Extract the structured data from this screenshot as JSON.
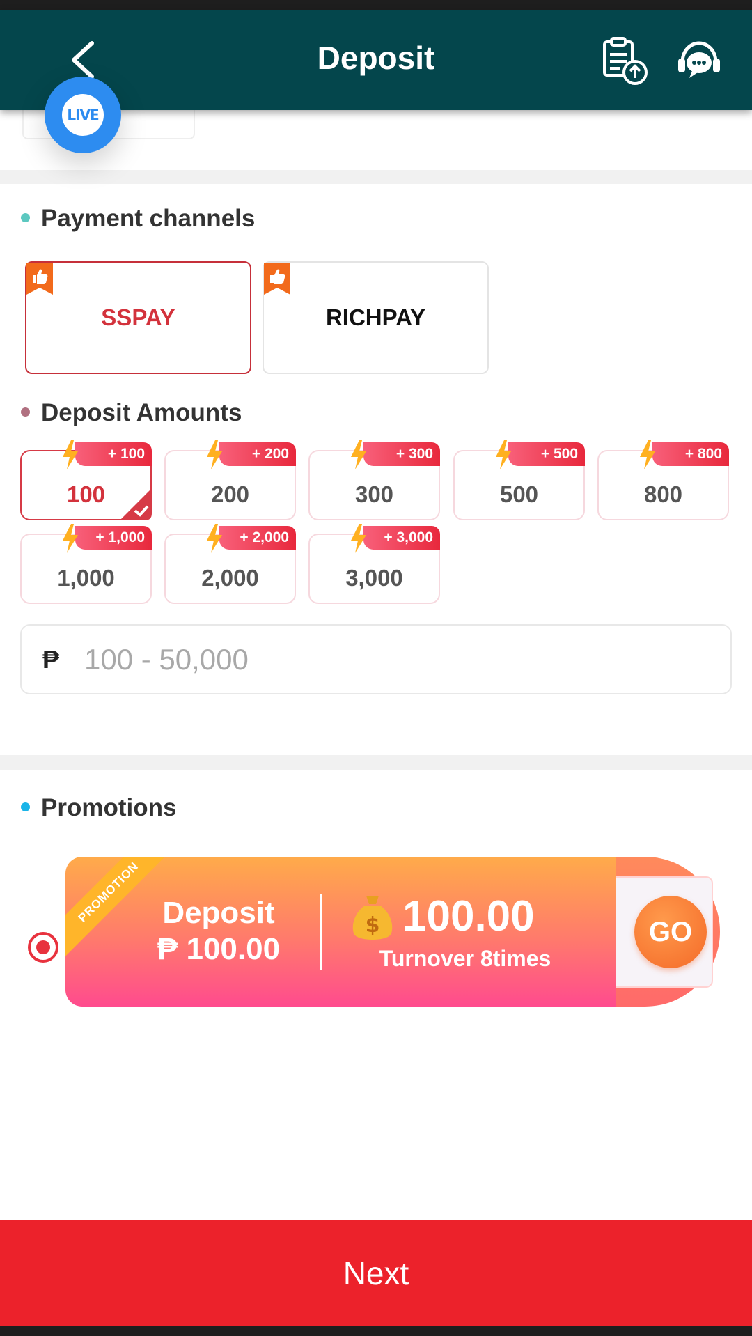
{
  "header": {
    "title": "Deposit",
    "bg_color": "#04464c",
    "back_icon": "chevron-left-icon",
    "upload_icon": "clipboard-upload-icon",
    "support_icon": "headset-chat-icon"
  },
  "live_badge": {
    "label": "LIVE",
    "color": "#2d8cf0"
  },
  "payment": {
    "title": "Payment channels",
    "dot_color": "#5cc8c0",
    "channels": [
      {
        "label": "SSPAY",
        "selected": true,
        "tag_icon": "thumbs-up-icon"
      },
      {
        "label": "RICHPAY",
        "selected": false,
        "tag_icon": "thumbs-up-icon"
      }
    ]
  },
  "amounts": {
    "title": "Deposit Amounts",
    "dot_color": "#b07080",
    "options": [
      {
        "value": "100",
        "bonus": "+ 100",
        "selected": true
      },
      {
        "value": "200",
        "bonus": "+ 200",
        "selected": false
      },
      {
        "value": "300",
        "bonus": "+ 300",
        "selected": false
      },
      {
        "value": "500",
        "bonus": "+ 500",
        "selected": false
      },
      {
        "value": "800",
        "bonus": "+ 800",
        "selected": false
      },
      {
        "value": "1,000",
        "bonus": "+ 1,000",
        "selected": false
      },
      {
        "value": "2,000",
        "bonus": "+ 2,000",
        "selected": false
      },
      {
        "value": "3,000",
        "bonus": "+ 3,000",
        "selected": false
      }
    ],
    "input": {
      "currency_symbol": "₱",
      "value": "",
      "placeholder": "100 - 50,000"
    }
  },
  "promotions": {
    "title": "Promotions",
    "dot_color": "#1ab4e8",
    "item": {
      "ribbon": "PROMOTION",
      "deposit_label": "Deposit",
      "deposit_amount": "₱ 100.00",
      "bonus_amount": "100.00",
      "turnover": "Turnover 8times",
      "go_label": "GO",
      "selected": true,
      "bag_icon": "money-bag-icon"
    }
  },
  "footer": {
    "next_label": "Next",
    "color": "#ec222b"
  }
}
